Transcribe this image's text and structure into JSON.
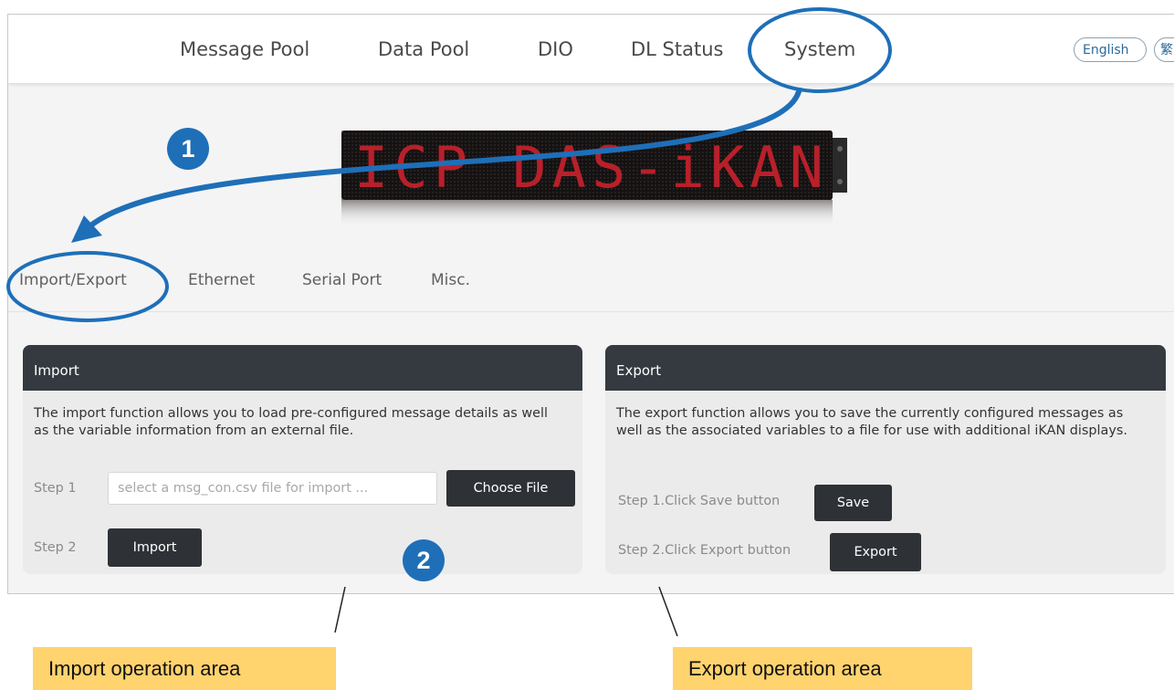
{
  "nav": {
    "items": [
      "Message Pool",
      "Data Pool",
      "DIO",
      "DL Status",
      "System"
    ],
    "languages": [
      "English",
      "繁"
    ]
  },
  "banner": {
    "text": "ICP DAS-iKAN"
  },
  "tabs": [
    "Import/Export",
    "Ethernet",
    "Serial Port",
    "Misc."
  ],
  "import": {
    "title": "Import",
    "description": "The import function allows you to load pre-configured message details as well as the variable information from an external file.",
    "step1_label": "Step 1",
    "file_placeholder": "select a msg_con.csv file for import ...",
    "choose_file_label": "Choose File",
    "step2_label": "Step 2",
    "import_label": "Import"
  },
  "export": {
    "title": "Export",
    "description": "The export function allows you to save the currently configured messages as well as the associated variables to a file for use with additional iKAN displays.",
    "step1_label": "Step 1.Click Save button",
    "save_label": "Save",
    "step2_label": "Step 2.Click Export button",
    "export_label": "Export"
  },
  "annotations": {
    "badge1": "1",
    "badge2": "2",
    "import_callout": "Import operation area",
    "export_callout": "Export operation area",
    "accent_color": "#1e6fb8",
    "callout_color": "#ffd36e"
  }
}
